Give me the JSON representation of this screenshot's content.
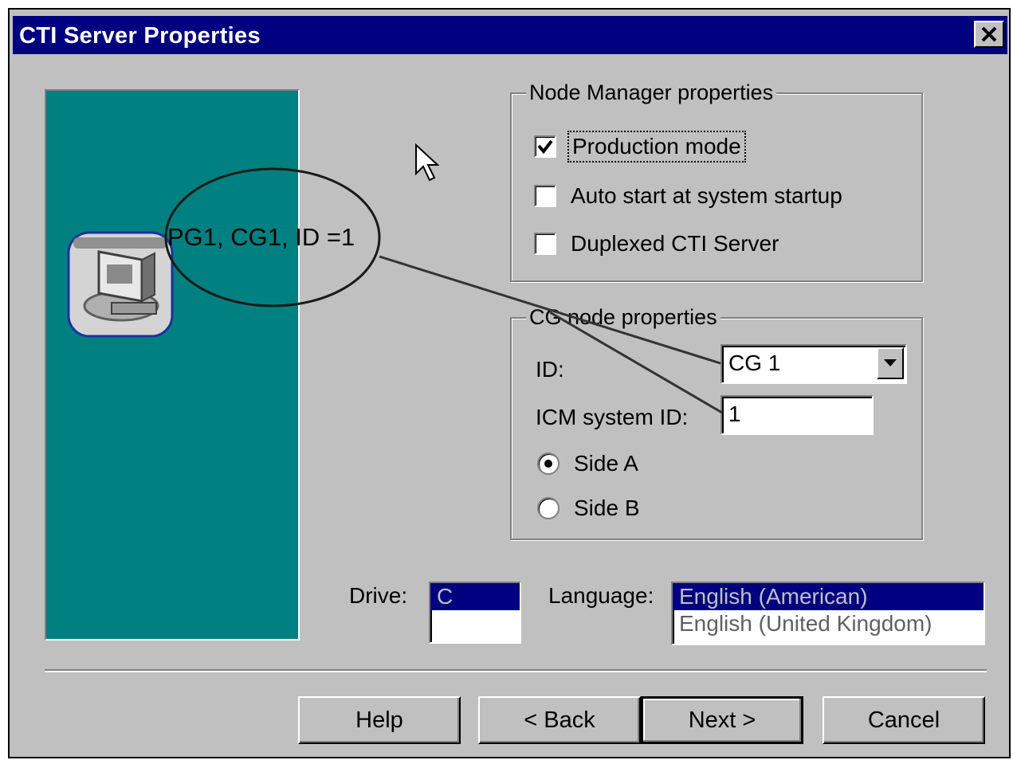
{
  "window": {
    "title": "CTI Server Properties"
  },
  "node_manager": {
    "title": "Node Manager properties",
    "production_mode_label": "Production mode",
    "production_mode_checked": true,
    "auto_start_label": "Auto start at system startup",
    "auto_start_checked": false,
    "duplexed_label": "Duplexed CTI Server",
    "duplexed_checked": false
  },
  "cg_node": {
    "title": "CG node properties",
    "id_label": "ID:",
    "id_value": "CG 1",
    "icm_label": "ICM system ID:",
    "icm_value": "1",
    "side_a_label": "Side A",
    "side_b_label": "Side B",
    "selected_side": "Side A"
  },
  "drive": {
    "label": "Drive:",
    "options": [
      "C"
    ],
    "selected": "C"
  },
  "language": {
    "label": "Language:",
    "options": [
      "English (American)",
      "English (United Kingdom)"
    ],
    "selected": "English (American)"
  },
  "buttons": {
    "help": "Help",
    "back": "< Back",
    "next": "Next >",
    "cancel": "Cancel"
  },
  "annotation": {
    "text": "PG1, CG1, ID =1"
  },
  "colors": {
    "titlebar": "#000080",
    "dialog_bg": "#c0c0c0",
    "banner": "#008080",
    "selection": "#000080"
  },
  "icons": {
    "close": "close-icon",
    "dropdown": "chevron-down-icon",
    "checkmark": "checkmark-icon",
    "cursor": "mouse-pointer-icon",
    "app": "computer-server-icon"
  }
}
